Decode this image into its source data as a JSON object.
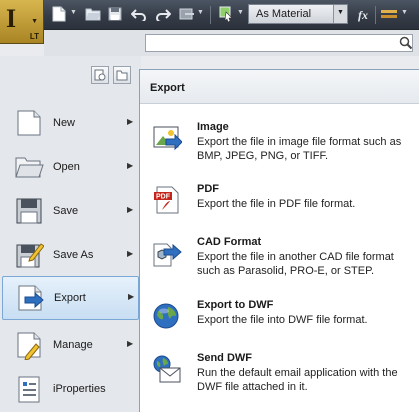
{
  "app": {
    "logo_letter": "I",
    "license_badge": "LT"
  },
  "toolbar": {
    "icons": [
      "new-icon",
      "open-icon",
      "save-icon",
      "undo-icon",
      "redo-icon",
      "return-icon",
      "select-icon",
      "material-icon",
      "fx-icon",
      "appearance-icon"
    ],
    "material_value": "As Material",
    "fx_label": "fx"
  },
  "search": {
    "value": "",
    "placeholder": ""
  },
  "menu": {
    "items": [
      {
        "label": "New",
        "icon": "new-document-icon",
        "has_submenu": true
      },
      {
        "label": "Open",
        "icon": "open-folder-icon",
        "has_submenu": true
      },
      {
        "label": "Save",
        "icon": "floppy-disk-icon",
        "has_submenu": true
      },
      {
        "label": "Save As",
        "icon": "save-as-icon",
        "has_submenu": true
      },
      {
        "label": "Export",
        "icon": "export-icon",
        "has_submenu": true,
        "active": true
      },
      {
        "label": "Manage",
        "icon": "manage-icon",
        "has_submenu": true
      },
      {
        "label": "iProperties",
        "icon": "iproperties-icon",
        "has_submenu": false
      }
    ]
  },
  "submenu": {
    "title": "Export",
    "items": [
      {
        "title": "Image",
        "desc": "Export the file in image file format such as BMP, JPEG, PNG, or TIFF.",
        "icon": "image-icon"
      },
      {
        "title": "PDF",
        "desc": "Export the file in PDF file format.",
        "icon": "pdf-icon",
        "badge": "PDF"
      },
      {
        "title": "CAD Format",
        "desc": "Export the file in another CAD file format such as Parasolid, PRO-E, or STEP.",
        "icon": "cad-format-icon"
      },
      {
        "title": "Export to DWF",
        "desc": "Export the file into DWF file format.",
        "icon": "dwf-globe-icon"
      },
      {
        "title": "Send DWF",
        "desc": "Run the default email application with the DWF file attached in it.",
        "icon": "send-dwf-icon"
      }
    ]
  },
  "colors": {
    "toolbar_bg": "#353c47",
    "app_button": "#c4a03a",
    "active_item": "#c8def3",
    "accent_blue": "#2f6fc0"
  }
}
